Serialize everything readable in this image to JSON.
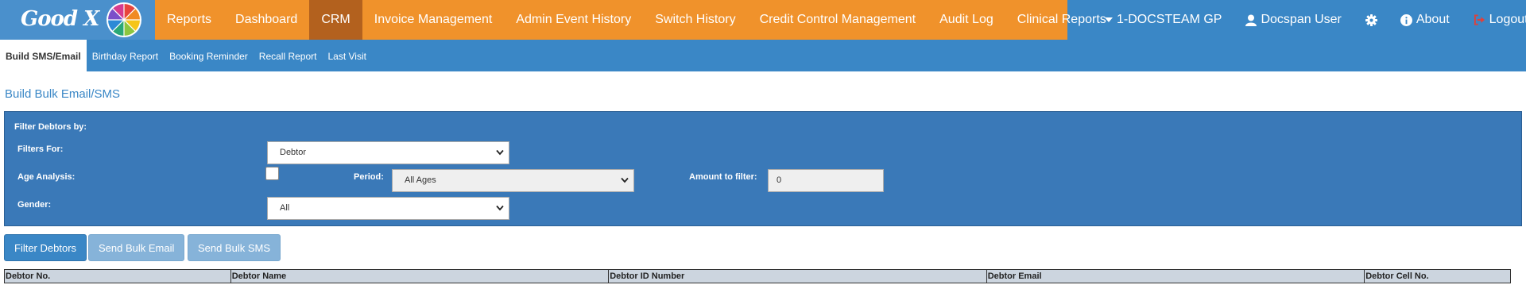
{
  "brand": {
    "logo_text": "Good X"
  },
  "nav": {
    "items": [
      "Reports",
      "Dashboard",
      "CRM",
      "Invoice Management",
      "Admin Event History",
      "Switch History",
      "Credit Control Management",
      "Audit Log",
      "Clinical Reports"
    ],
    "active": "CRM"
  },
  "right_nav": {
    "practice": "1-DOCSTEAM GP",
    "user": "Docspan User",
    "about": "About",
    "logout": "Logout"
  },
  "subnav": {
    "items": [
      "Build SMS/Email",
      "Birthday Report",
      "Booking Reminder",
      "Recall Report",
      "Last Visit"
    ],
    "active": "Build SMS/Email"
  },
  "page": {
    "title": "Build Bulk Email/SMS"
  },
  "filter": {
    "heading": "Filter Debtors by:",
    "filters_for_label": "Filters For:",
    "filters_for_value": "Debtor",
    "age_analysis_label": "Age Analysis:",
    "age_analysis_checked": false,
    "period_label": "Period:",
    "period_value": "All Ages",
    "amount_label": "Amount to filter:",
    "amount_value": "0",
    "gender_label": "Gender:",
    "gender_value": "All"
  },
  "buttons": {
    "filter_debtors": "Filter Debtors",
    "send_bulk_email": "Send Bulk Email",
    "send_bulk_sms": "Send Bulk SMS"
  },
  "table": {
    "columns": [
      "Debtor No.",
      "Debtor Name",
      "Debtor ID Number",
      "Debtor Email",
      "Debtor Cell No."
    ]
  },
  "colors": {
    "primary_blue": "#3a87c6",
    "nav_orange": "#f0922b",
    "active_orange": "#b3611e",
    "panel_blue": "#3a79b8",
    "logout_red": "#e0403a"
  }
}
